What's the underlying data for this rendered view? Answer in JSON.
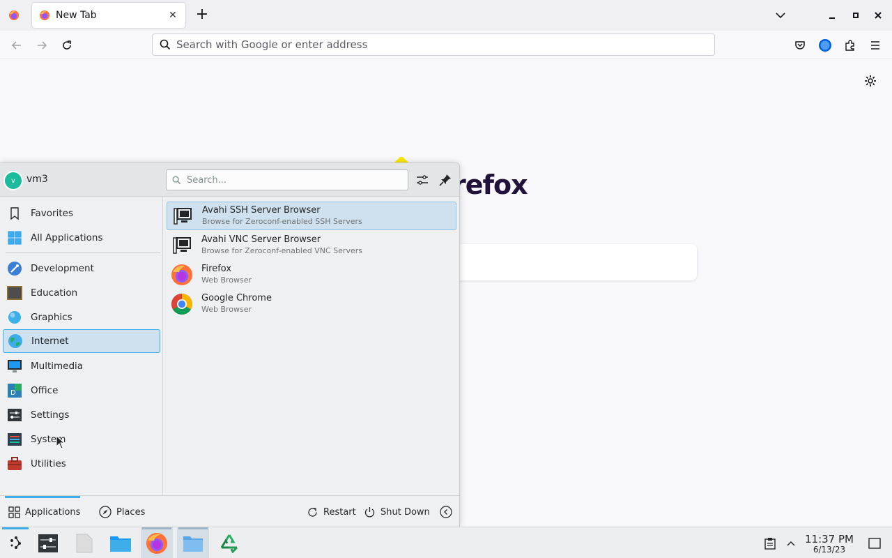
{
  "browser": {
    "tab_title": "New Tab",
    "address_placeholder": "Search with Google or enter address",
    "brand_wordmark": "refox"
  },
  "launcher": {
    "user_name": "vm3",
    "user_initial": "v",
    "search_placeholder": "Search...",
    "categories": [
      {
        "label": "Favorites",
        "icon": "bookmark-icon"
      },
      {
        "label": "All Applications",
        "icon": "grid-apps-icon"
      },
      {
        "label": "Development",
        "icon": "development-icon"
      },
      {
        "label": "Education",
        "icon": "education-icon"
      },
      {
        "label": "Graphics",
        "icon": "graphics-icon"
      },
      {
        "label": "Internet",
        "icon": "globe-icon",
        "selected": true
      },
      {
        "label": "Multimedia",
        "icon": "multimedia-icon"
      },
      {
        "label": "Office",
        "icon": "office-icon"
      },
      {
        "label": "Settings",
        "icon": "settings-icon"
      },
      {
        "label": "System",
        "icon": "system-icon"
      },
      {
        "label": "Utilities",
        "icon": "utilities-icon"
      }
    ],
    "apps": [
      {
        "name": "Avahi SSH Server Browser",
        "description": "Browse for Zeroconf-enabled SSH Servers",
        "icon": "network-computer-icon",
        "selected": true
      },
      {
        "name": "Avahi VNC Server Browser",
        "description": "Browse for Zeroconf-enabled VNC Servers",
        "icon": "network-computer-icon"
      },
      {
        "name": "Firefox",
        "description": "Web Browser",
        "icon": "firefox-icon"
      },
      {
        "name": "Google Chrome",
        "description": "Web Browser",
        "icon": "chrome-icon"
      }
    ],
    "footer": {
      "applications": "Applications",
      "places": "Places",
      "restart": "Restart",
      "shutdown": "Shut Down"
    }
  },
  "taskbar": {
    "time": "11:37 PM",
    "date": "6/13/23"
  },
  "colors": {
    "accent": "#3daee9",
    "selection": "#cfe1ee"
  }
}
